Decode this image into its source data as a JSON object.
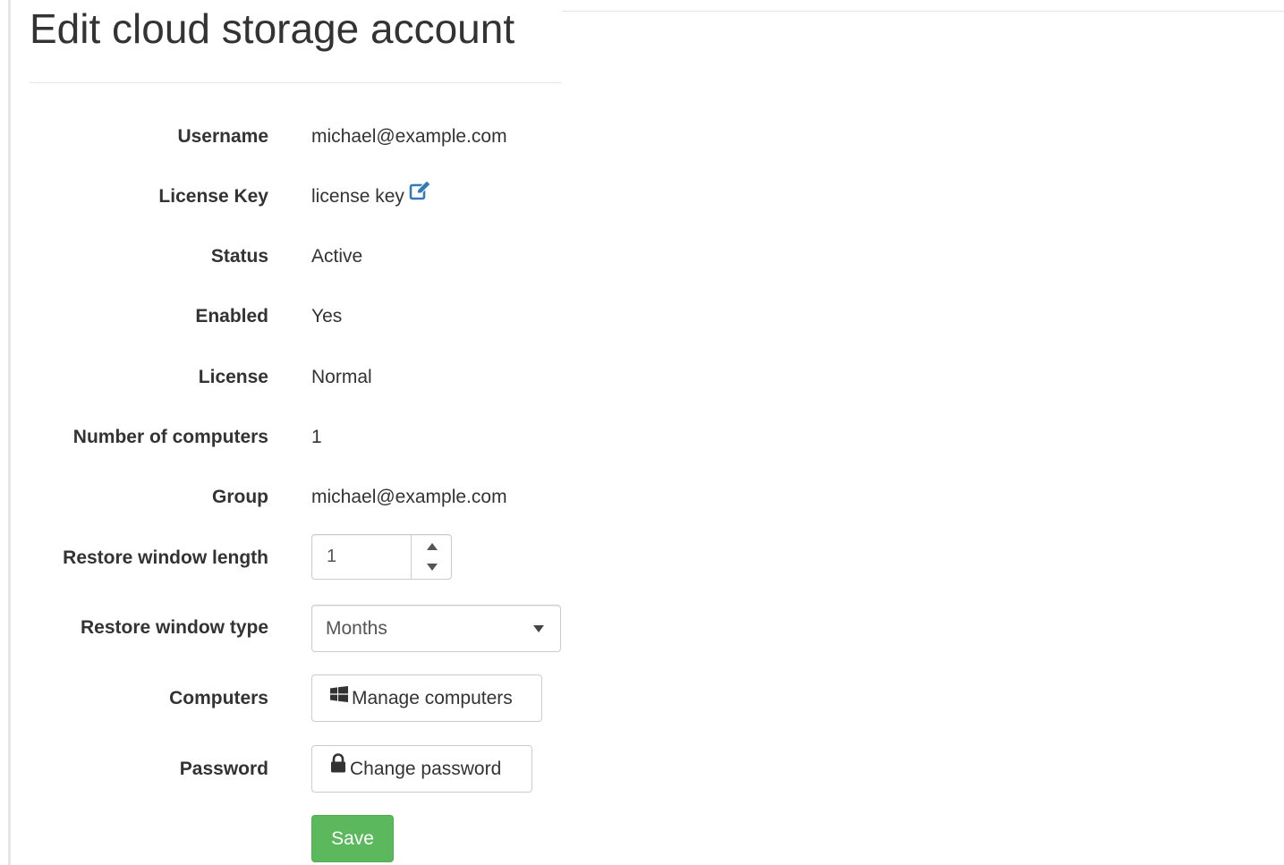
{
  "page": {
    "title": "Edit cloud storage account"
  },
  "fields": {
    "username": {
      "label": "Username",
      "value": "michael@example.com"
    },
    "license_key": {
      "label": "License Key",
      "value": "license key",
      "edit_icon": "edit-icon"
    },
    "status": {
      "label": "Status",
      "value": "Active"
    },
    "enabled": {
      "label": "Enabled",
      "value": "Yes"
    },
    "license": {
      "label": "License",
      "value": "Normal"
    },
    "number_of_computers": {
      "label": "Number of computers",
      "value": "1"
    },
    "group": {
      "label": "Group",
      "value": "michael@example.com"
    },
    "restore_window_length": {
      "label": "Restore window length",
      "value": "1"
    },
    "restore_window_type": {
      "label": "Restore window type",
      "selected": "Months"
    },
    "computers": {
      "label": "Computers",
      "button_label": "Manage computers",
      "icon": "windows-icon"
    },
    "password": {
      "label": "Password",
      "button_label": "Change password",
      "icon": "lock-icon"
    }
  },
  "actions": {
    "save_label": "Save"
  },
  "colors": {
    "accent_blue": "#337ab7",
    "save_green": "#5cb85c",
    "text": "#333333"
  }
}
